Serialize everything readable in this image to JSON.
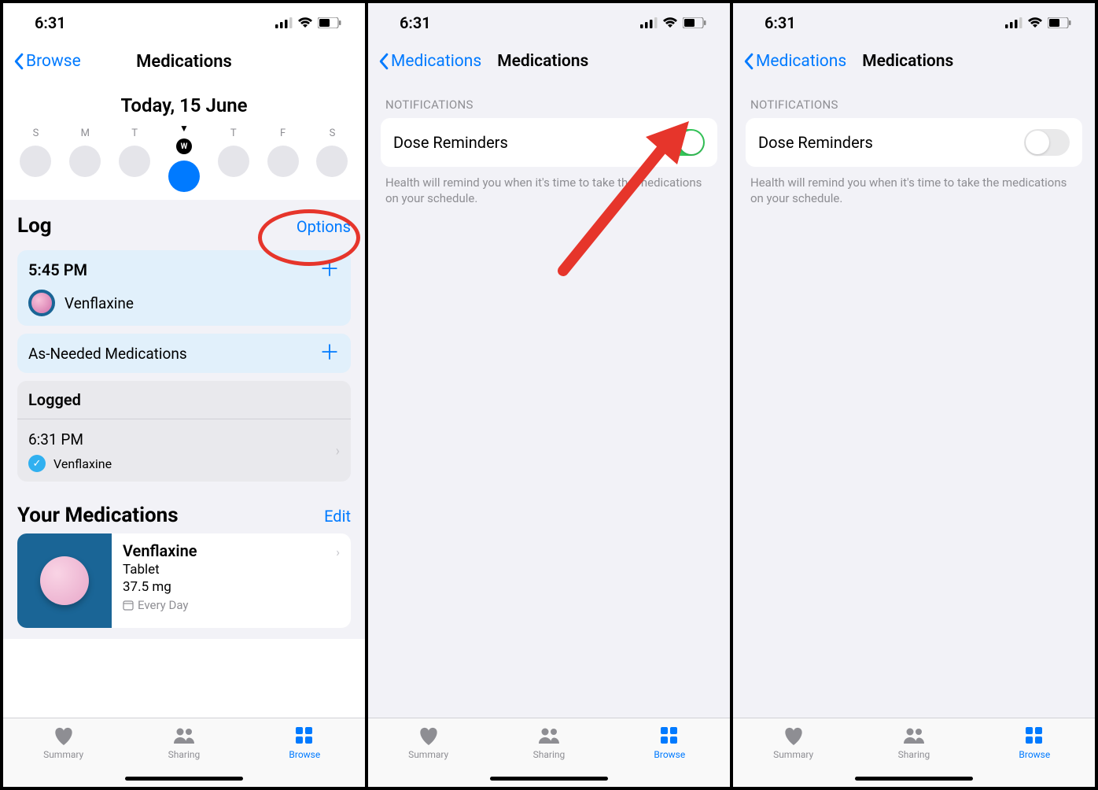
{
  "status": {
    "time": "6:31"
  },
  "screen1": {
    "back_label": "Browse",
    "title": "Medications",
    "today_label": "Today, 15 June",
    "calendar": {
      "days": [
        "S",
        "M",
        "T",
        "W",
        "T",
        "F",
        "S"
      ],
      "today_badge": "W",
      "active_index": 3
    },
    "log": {
      "heading": "Log",
      "options_label": "Options",
      "entry_time": "5:45 PM",
      "entry_med": "Venflaxine",
      "as_needed_label": "As-Needed Medications",
      "logged_heading": "Logged",
      "logged_time": "6:31 PM",
      "logged_med": "Venflaxine"
    },
    "your_meds": {
      "heading": "Your Medications",
      "edit_label": "Edit",
      "med_name": "Venflaxine",
      "med_form": "Tablet",
      "med_dose": "37.5 mg",
      "med_schedule": "Every Day"
    }
  },
  "screen2": {
    "back_label": "Medications",
    "title": "Medications",
    "group_header": "NOTIFICATIONS",
    "setting_label": "Dose Reminders",
    "toggle_on": true,
    "footer": "Health will remind you when it's time to take the medications on your schedule."
  },
  "screen3": {
    "back_label": "Medications",
    "title": "Medications",
    "group_header": "NOTIFICATIONS",
    "setting_label": "Dose Reminders",
    "toggle_on": false,
    "footer": "Health will remind you when it's time to take the medications on your schedule."
  },
  "tabs": {
    "summary": "Summary",
    "sharing": "Sharing",
    "browse": "Browse"
  }
}
